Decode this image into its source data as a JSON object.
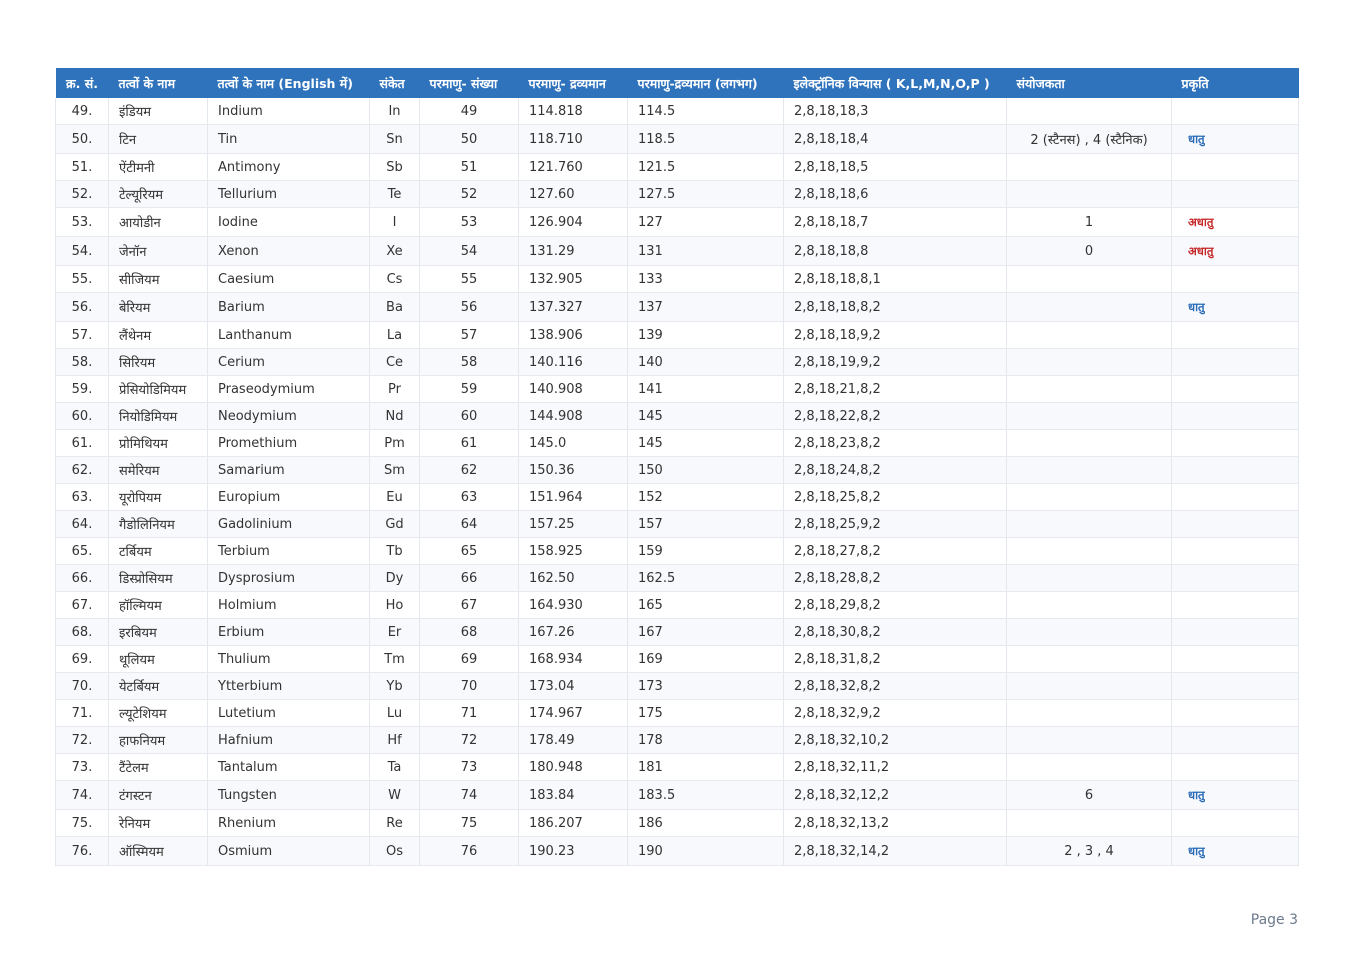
{
  "table": {
    "headers": [
      "क्र. सं.",
      "तत्वों के नाम",
      "तत्वों के नाम (English में)",
      "संकेत",
      "परमाणु- संख्या",
      "परमाणु- द्रव्यमान",
      "परमाणु-द्रव्यमान (लगभग)",
      "इलेक्ट्रॉनिक विन्यास ( K,L,M,N,O,P )",
      "संयोजकता",
      "प्रकृति"
    ],
    "rows": [
      {
        "sn": "49.",
        "hindi": "इंडियम",
        "english": "Indium",
        "symbol": "In",
        "number": "49",
        "mass": "114.818",
        "approx": "114.5",
        "config": "2,8,18,18,3",
        "valency": "",
        "nature": "",
        "nature_type": ""
      },
      {
        "sn": "50.",
        "hindi": "टिन",
        "english": "Tin",
        "symbol": "Sn",
        "number": "50",
        "mass": "118.710",
        "approx": "118.5",
        "config": "2,8,18,18,4",
        "valency": "2 (स्टैनस) , 4 (स्टैनिक)",
        "nature": "धातु",
        "nature_type": "metal"
      },
      {
        "sn": "51.",
        "hindi": "ऐंटीमनी",
        "english": "Antimony",
        "symbol": "Sb",
        "number": "51",
        "mass": "121.760",
        "approx": "121.5",
        "config": "2,8,18,18,5",
        "valency": "",
        "nature": "",
        "nature_type": ""
      },
      {
        "sn": "52.",
        "hindi": "टेल्यूरियम",
        "english": "Tellurium",
        "symbol": "Te",
        "number": "52",
        "mass": "127.60",
        "approx": "127.5",
        "config": "2,8,18,18,6",
        "valency": "",
        "nature": "",
        "nature_type": ""
      },
      {
        "sn": "53.",
        "hindi": "आयोडीन",
        "english": "Iodine",
        "symbol": "I",
        "number": "53",
        "mass": "126.904",
        "approx": "127",
        "config": "2,8,18,18,7",
        "valency": "1",
        "nature": "अधातु",
        "nature_type": "nonmetal"
      },
      {
        "sn": "54.",
        "hindi": "जेनॉन",
        "english": "Xenon",
        "symbol": "Xe",
        "number": "54",
        "mass": "131.29",
        "approx": "131",
        "config": "2,8,18,18,8",
        "valency": "0",
        "nature": "अधातु",
        "nature_type": "nonmetal"
      },
      {
        "sn": "55.",
        "hindi": "सीजियम",
        "english": "Caesium",
        "symbol": "Cs",
        "number": "55",
        "mass": "132.905",
        "approx": "133",
        "config": "2,8,18,18,8,1",
        "valency": "",
        "nature": "",
        "nature_type": ""
      },
      {
        "sn": "56.",
        "hindi": "बेरियम",
        "english": "Barium",
        "symbol": "Ba",
        "number": "56",
        "mass": "137.327",
        "approx": "137",
        "config": "2,8,18,18,8,2",
        "valency": "",
        "nature": "धातु",
        "nature_type": "metal"
      },
      {
        "sn": "57.",
        "hindi": "लैंथेनम",
        "english": "Lanthanum",
        "symbol": "La",
        "number": "57",
        "mass": "138.906",
        "approx": "139",
        "config": "2,8,18,18,9,2",
        "valency": "",
        "nature": "",
        "nature_type": ""
      },
      {
        "sn": "58.",
        "hindi": "सिरियम",
        "english": "Cerium",
        "symbol": "Ce",
        "number": "58",
        "mass": "140.116",
        "approx": "140",
        "config": "2,8,18,19,9,2",
        "valency": "",
        "nature": "",
        "nature_type": ""
      },
      {
        "sn": "59.",
        "hindi": "प्रेसियोडिमियम",
        "english": "Praseodymium",
        "symbol": "Pr",
        "number": "59",
        "mass": "140.908",
        "approx": "141",
        "config": "2,8,18,21,8,2",
        "valency": "",
        "nature": "",
        "nature_type": ""
      },
      {
        "sn": "60.",
        "hindi": "नियोडिमियम",
        "english": "Neodymium",
        "symbol": "Nd",
        "number": "60",
        "mass": "144.908",
        "approx": "145",
        "config": "2,8,18,22,8,2",
        "valency": "",
        "nature": "",
        "nature_type": ""
      },
      {
        "sn": "61.",
        "hindi": "प्रोमिथियम",
        "english": "Promethium",
        "symbol": "Pm",
        "number": "61",
        "mass": "145.0",
        "approx": "145",
        "config": "2,8,18,23,8,2",
        "valency": "",
        "nature": "",
        "nature_type": ""
      },
      {
        "sn": "62.",
        "hindi": "समेरियम",
        "english": "Samarium",
        "symbol": "Sm",
        "number": "62",
        "mass": "150.36",
        "approx": "150",
        "config": "2,8,18,24,8,2",
        "valency": "",
        "nature": "",
        "nature_type": ""
      },
      {
        "sn": "63.",
        "hindi": "यूरोपियम",
        "english": "Europium",
        "symbol": "Eu",
        "number": "63",
        "mass": "151.964",
        "approx": "152",
        "config": "2,8,18,25,8,2",
        "valency": "",
        "nature": "",
        "nature_type": ""
      },
      {
        "sn": "64.",
        "hindi": "गैडोलिनियम",
        "english": "Gadolinium",
        "symbol": "Gd",
        "number": "64",
        "mass": "157.25",
        "approx": "157",
        "config": "2,8,18,25,9,2",
        "valency": "",
        "nature": "",
        "nature_type": ""
      },
      {
        "sn": "65.",
        "hindi": "टर्बियम",
        "english": "Terbium",
        "symbol": "Tb",
        "number": "65",
        "mass": "158.925",
        "approx": "159",
        "config": "2,8,18,27,8,2",
        "valency": "",
        "nature": "",
        "nature_type": ""
      },
      {
        "sn": "66.",
        "hindi": "डिस्प्रोसियम",
        "english": "Dysprosium",
        "symbol": "Dy",
        "number": "66",
        "mass": "162.50",
        "approx": "162.5",
        "config": "2,8,18,28,8,2",
        "valency": "",
        "nature": "",
        "nature_type": ""
      },
      {
        "sn": "67.",
        "hindi": "हॉल्मियम",
        "english": "Holmium",
        "symbol": "Ho",
        "number": "67",
        "mass": "164.930",
        "approx": "165",
        "config": "2,8,18,29,8,2",
        "valency": "",
        "nature": "",
        "nature_type": ""
      },
      {
        "sn": "68.",
        "hindi": "इरबियम",
        "english": "Erbium",
        "symbol": "Er",
        "number": "68",
        "mass": "167.26",
        "approx": "167",
        "config": "2,8,18,30,8,2",
        "valency": "",
        "nature": "",
        "nature_type": ""
      },
      {
        "sn": "69.",
        "hindi": "थूलियम",
        "english": "Thulium",
        "symbol": "Tm",
        "number": "69",
        "mass": "168.934",
        "approx": "169",
        "config": "2,8,18,31,8,2",
        "valency": "",
        "nature": "",
        "nature_type": ""
      },
      {
        "sn": "70.",
        "hindi": "येटर्बियम",
        "english": "Ytterbium",
        "symbol": "Yb",
        "number": "70",
        "mass": "173.04",
        "approx": "173",
        "config": "2,8,18,32,8,2",
        "valency": "",
        "nature": "",
        "nature_type": ""
      },
      {
        "sn": "71.",
        "hindi": "ल्यूटेशियम",
        "english": "Lutetium",
        "symbol": "Lu",
        "number": "71",
        "mass": "174.967",
        "approx": "175",
        "config": "2,8,18,32,9,2",
        "valency": "",
        "nature": "",
        "nature_type": ""
      },
      {
        "sn": "72.",
        "hindi": "हाफनियम",
        "english": "Hafnium",
        "symbol": "Hf",
        "number": "72",
        "mass": "178.49",
        "approx": "178",
        "config": "2,8,18,32,10,2",
        "valency": "",
        "nature": "",
        "nature_type": ""
      },
      {
        "sn": "73.",
        "hindi": "टैंटेलम",
        "english": "Tantalum",
        "symbol": "Ta",
        "number": "73",
        "mass": "180.948",
        "approx": "181",
        "config": "2,8,18,32,11,2",
        "valency": "",
        "nature": "",
        "nature_type": ""
      },
      {
        "sn": "74.",
        "hindi": "टंगस्टन",
        "english": "Tungsten",
        "symbol": "W",
        "number": "74",
        "mass": "183.84",
        "approx": "183.5",
        "config": "2,8,18,32,12,2",
        "valency": "6",
        "nature": "धातु",
        "nature_type": "metal"
      },
      {
        "sn": "75.",
        "hindi": "रेनियम",
        "english": "Rhenium",
        "symbol": "Re",
        "number": "75",
        "mass": "186.207",
        "approx": "186",
        "config": "2,8,18,32,13,2",
        "valency": "",
        "nature": "",
        "nature_type": ""
      },
      {
        "sn": "76.",
        "hindi": "ऑस्मियम",
        "english": "Osmium",
        "symbol": "Os",
        "number": "76",
        "mass": "190.23",
        "approx": "190",
        "config": "2,8,18,32,14,2",
        "valency": "2 , 3 , 4",
        "nature": "धातु",
        "nature_type": "metal"
      }
    ]
  },
  "colors": {
    "header_bg": "#2f73bd",
    "metal": "#2b6cb8",
    "nonmetal": "#c62828"
  },
  "footer": {
    "page_label": "Page 3"
  }
}
